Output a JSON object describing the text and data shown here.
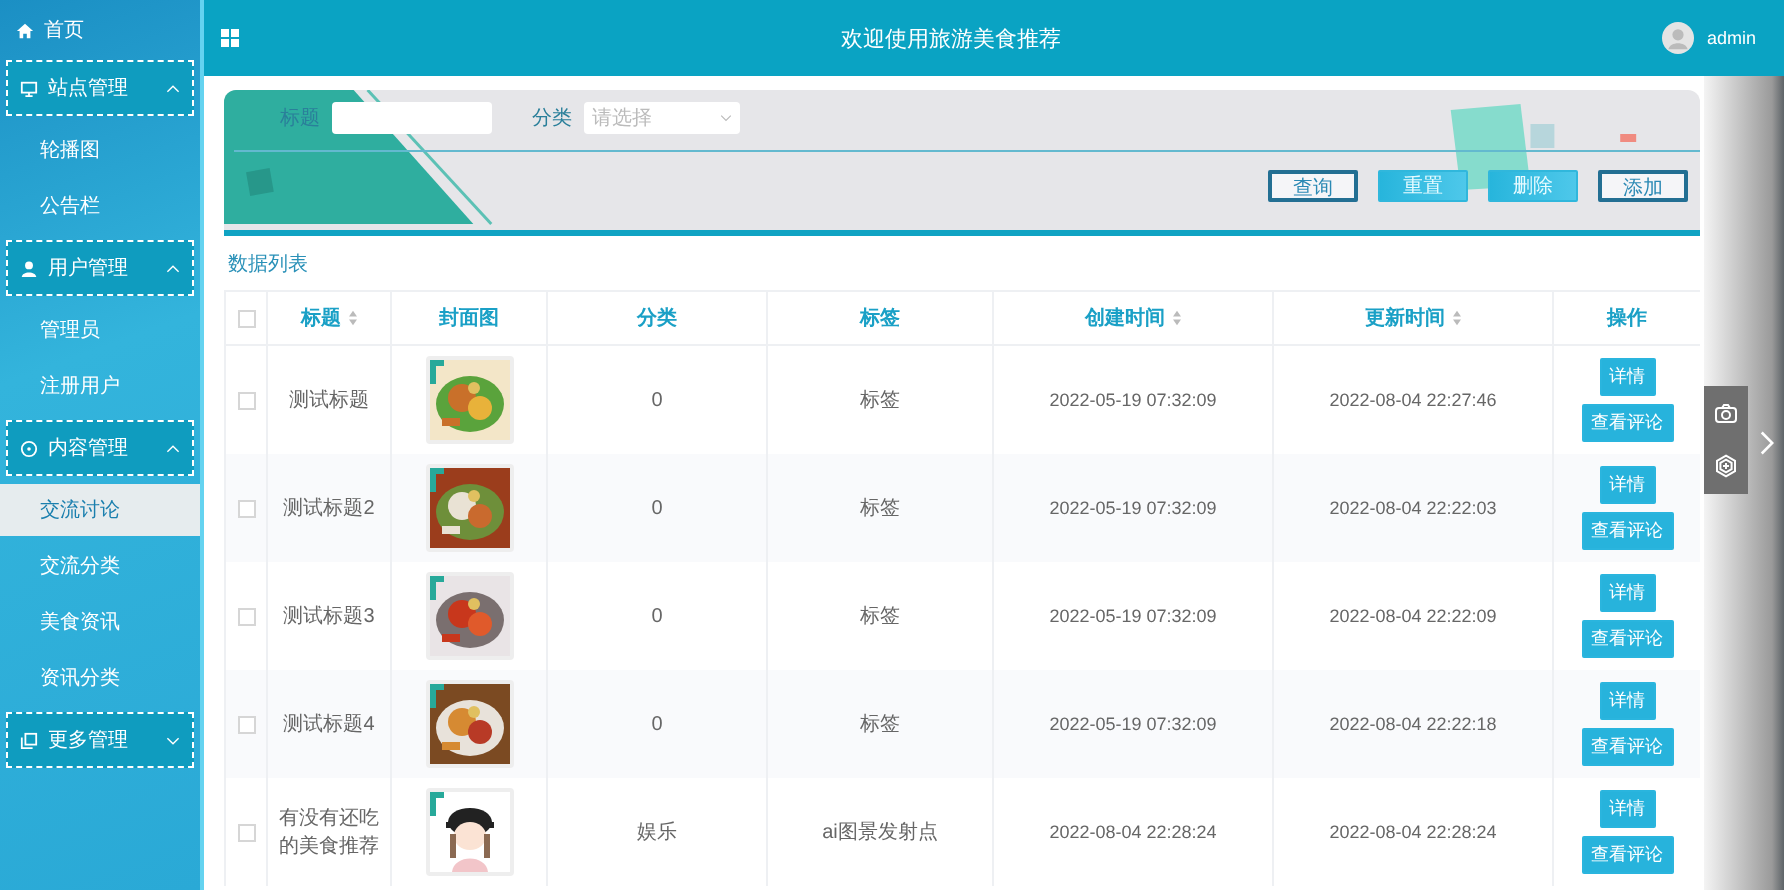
{
  "sidebar": {
    "items": [
      {
        "label": "首页",
        "kind": "link"
      },
      {
        "label": "站点管理",
        "kind": "group",
        "expanded": true,
        "children": [
          {
            "label": "轮播图",
            "selected": false
          },
          {
            "label": "公告栏",
            "selected": false
          }
        ]
      },
      {
        "label": "用户管理",
        "kind": "group",
        "expanded": true,
        "children": [
          {
            "label": "管理员",
            "selected": false
          },
          {
            "label": "注册用户",
            "selected": false
          }
        ]
      },
      {
        "label": "内容管理",
        "kind": "group",
        "expanded": true,
        "children": [
          {
            "label": "交流讨论",
            "selected": true
          },
          {
            "label": "交流分类",
            "selected": false
          },
          {
            "label": "美食资讯",
            "selected": false
          },
          {
            "label": "资讯分类",
            "selected": false
          }
        ]
      },
      {
        "label": "更多管理",
        "kind": "group",
        "expanded": false
      }
    ]
  },
  "topbar": {
    "title": "欢迎使用旅游美食推荐",
    "user": "admin"
  },
  "search": {
    "fields": [
      {
        "label": "标题",
        "kind": "text"
      },
      {
        "label": "分类",
        "kind": "select",
        "placeholder": "请选择"
      }
    ],
    "buttons": [
      {
        "label": "查询",
        "kind": "outline"
      },
      {
        "label": "重置",
        "kind": "solid"
      },
      {
        "label": "删除",
        "kind": "solid"
      },
      {
        "label": "添加",
        "kind": "outline"
      }
    ]
  },
  "section_title": "数据列表",
  "table": {
    "all_checked": false,
    "columns": [
      {
        "label": "标题",
        "sortable": true
      },
      {
        "label": "封面图",
        "sortable": false
      },
      {
        "label": "分类",
        "sortable": false
      },
      {
        "label": "标签",
        "sortable": false
      },
      {
        "label": "创建时间",
        "sortable": true
      },
      {
        "label": "更新时间",
        "sortable": true
      },
      {
        "label": "操作",
        "sortable": false
      }
    ],
    "rows": [
      {
        "checked": false,
        "title": "测试标题",
        "category": "0",
        "tag": "标签",
        "created": "2022-05-19 07:32:09",
        "updated": "2022-08-04 22:27:46",
        "actions": [
          "详情",
          "查看评论"
        ]
      },
      {
        "checked": false,
        "title": "测试标题2",
        "category": "0",
        "tag": "标签",
        "created": "2022-05-19 07:32:09",
        "updated": "2022-08-04 22:22:03",
        "actions": [
          "详情",
          "查看评论"
        ]
      },
      {
        "checked": false,
        "title": "测试标题3",
        "category": "0",
        "tag": "标签",
        "created": "2022-05-19 07:32:09",
        "updated": "2022-08-04 22:22:09",
        "actions": [
          "详情",
          "查看评论"
        ]
      },
      {
        "checked": false,
        "title": "测试标题4",
        "category": "0",
        "tag": "标签",
        "created": "2022-05-19 07:32:09",
        "updated": "2022-08-04 22:22:18",
        "actions": [
          "详情",
          "查看评论"
        ]
      },
      {
        "checked": false,
        "title": "有没有还吃的美食推荐",
        "category": "娱乐",
        "tag": "ai图景发射点",
        "created": "2022-08-04 22:28:24",
        "updated": "2022-08-04 22:28:24",
        "actions": [
          "详情",
          "查看评论"
        ]
      }
    ]
  }
}
